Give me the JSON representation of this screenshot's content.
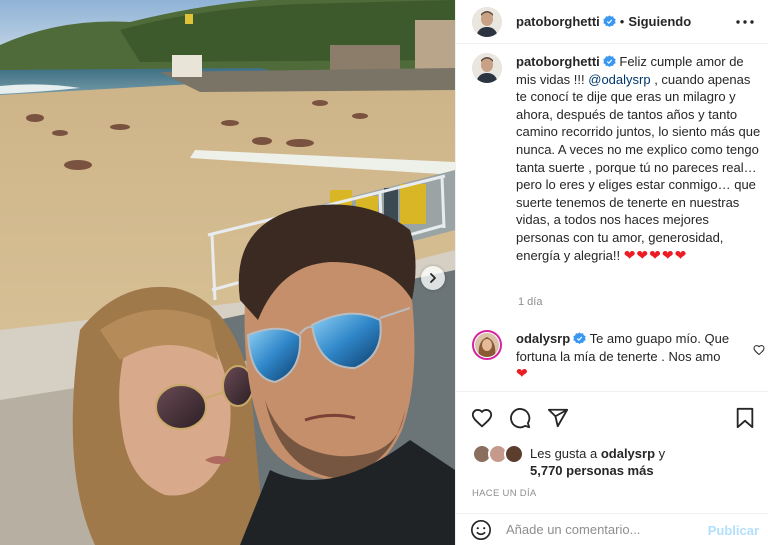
{
  "header": {
    "username": "patoborghetti",
    "separator": "•",
    "follow_label": "Siguiendo"
  },
  "caption": {
    "username": "patoborghetti",
    "text_before_mention": "Feliz cumple amor de mis vidas !!! ",
    "mention": "@odalysrp",
    "text_after_mention": " , cuando apenas te conocí te dije que eras un milagro y ahora, después de tantos años y tanto camino recorrido juntos, lo siento más que nunca. A veces no me explico como tengo tanta suerte , porque tú no pareces real… pero lo eres y eliges estar conmigo… que suerte tenemos de tenerte en nuestras vidas, a todos nos haces mejores personas con tu amor, generosidad, energía y alegria!! ",
    "hearts": "❤❤❤❤❤",
    "time": "1 día"
  },
  "comment": {
    "username": "odalysrp",
    "text": "Te amo guapo mío. Que fortuna la mía de tenerte . Nos amo",
    "hearts": "❤"
  },
  "likes": {
    "prefix": "Les gusta a ",
    "first_user": "odalysrp",
    "middle": " y",
    "others": "5,770 personas más"
  },
  "timestamp": "HACE UN DÍA",
  "comment_box": {
    "placeholder": "Añade un comentario...",
    "publish_label": "Publicar"
  },
  "icons": {
    "verified": "verified-badge-icon",
    "more": "more-options-icon",
    "like": "heart-icon",
    "comment": "comment-icon",
    "share": "share-icon",
    "save": "bookmark-icon",
    "emoji": "emoji-icon",
    "next": "chevron-right-icon"
  },
  "colors": {
    "verified_blue": "#3897f0",
    "link_blue": "#00376b",
    "heart_red": "#ed1c24",
    "muted_gray": "#8e8e8e",
    "publish_disabled": "#b2dffc"
  }
}
